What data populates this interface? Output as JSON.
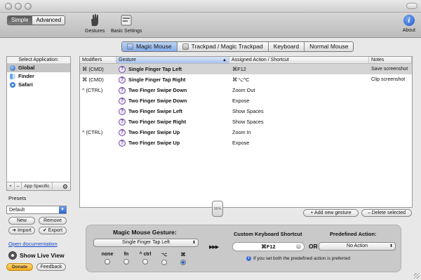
{
  "toolbar": {
    "mode_simple": "Simple",
    "mode_advanced": "Advanced",
    "gestures_label": "Gestures",
    "basic_settings_label": "Basic Settings",
    "about_label": "About"
  },
  "device_tabs": [
    "Magic Mouse",
    "Trackpad / Magic Trackpad",
    "Keyboard",
    "Normal Mouse"
  ],
  "sidebar": {
    "header": "Select Application:",
    "apps": [
      {
        "name": "Global",
        "icon": "globe-icon"
      },
      {
        "name": "Finder",
        "icon": "finder-icon"
      },
      {
        "name": "Safari",
        "icon": "safari-icon"
      }
    ],
    "footer_add": "+",
    "footer_remove": "–",
    "footer_app_specific": "App Specific",
    "footer_settings_icon": "gear-icon"
  },
  "presets": {
    "label": "Presets",
    "selected": "Default",
    "new_label": "New",
    "remove_label": "Remove",
    "import_label": "Import",
    "export_label": "Export"
  },
  "links": {
    "open_documentation": "Open documentation",
    "show_live_view": "Show Live View",
    "donate": "Donate",
    "feedback": "Feedback"
  },
  "table": {
    "headers": {
      "modifiers": "Modifiers",
      "gesture": "Gesture",
      "action": "Assigned Action / Shortcut",
      "notes": "Notes"
    },
    "rows": [
      {
        "modifiers": "⌘ (CMD)",
        "gesture": "Single Finger Tap Left",
        "action": "⌘F12",
        "notes": "Save screenshot"
      },
      {
        "modifiers": "⌘ (CMD)",
        "gesture": "Single Finger Tap Right",
        "action": "⌘⌥^C",
        "notes": "Clip screenshot"
      },
      {
        "modifiers": "^ (CTRL)",
        "gesture": "Two Finger Swipe Down",
        "action": "Zoom Out",
        "notes": ""
      },
      {
        "modifiers": "",
        "gesture": "Two Finger Swipe Down",
        "action": "Expose",
        "notes": ""
      },
      {
        "modifiers": "",
        "gesture": "Two Finger Swipe Left",
        "action": "Show Spaces",
        "notes": ""
      },
      {
        "modifiers": "",
        "gesture": "Two Finger Swipe Right",
        "action": "Show Spaces",
        "notes": ""
      },
      {
        "modifiers": "^ (CTRL)",
        "gesture": "Two Finger Swipe Up",
        "action": "Zoom In",
        "notes": ""
      },
      {
        "modifiers": "",
        "gesture": "Two Finger Swipe Up",
        "action": "Expose",
        "notes": ""
      }
    ]
  },
  "sensitivity_label": "36%",
  "table_actions": {
    "add": "Add new gesture",
    "delete": "Delete selected"
  },
  "gesture_panel": {
    "title": "Magic Mouse Gesture:",
    "selected_gesture": "Single Finger Tap Left",
    "modifiers": [
      "none",
      "fn",
      "^ ctrl",
      "⌥",
      "⌘"
    ],
    "selected_modifier_index": 4,
    "arrows": "▶▶▶",
    "shortcut_title": "Custom Keyboard Shortcut",
    "shortcut_value": "⌘F12",
    "or_label": "OR",
    "predefined_title": "Predefined Action:",
    "predefined_value": "No Action",
    "hint": "If you set both the predefined action is preferred"
  },
  "colors": {
    "accent": "#2a62d0",
    "selected_tab": "#a6c2ef",
    "link": "#1346c8"
  }
}
